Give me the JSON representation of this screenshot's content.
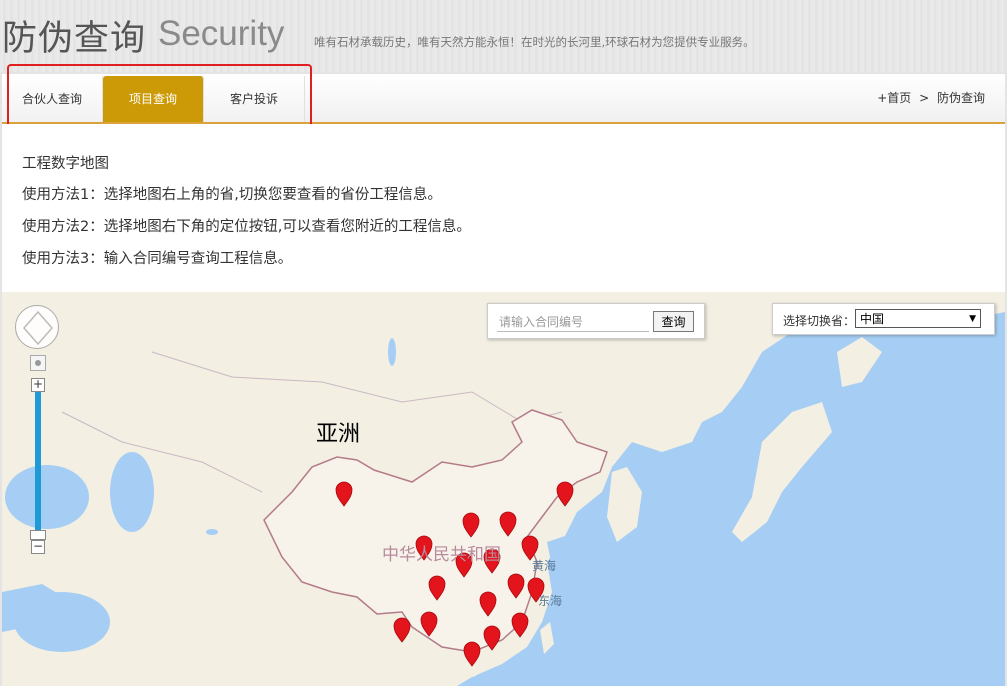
{
  "header": {
    "title_cn": "防伪查询",
    "title_en": "Security",
    "slogan": "唯有石材承载历史，唯有天然方能永恒！在时光的长河里,环球石材为您提供专业服务。"
  },
  "nav": {
    "tabs": [
      {
        "label": "合伙人查询",
        "active": false
      },
      {
        "label": "项目查询",
        "active": true
      },
      {
        "label": "客户投诉",
        "active": false
      }
    ],
    "breadcrumb": {
      "home": "+首页",
      "separator": ">",
      "current": "防伪查询"
    },
    "accent_color": "#cc9a07"
  },
  "content": {
    "heading": "工程数字地图",
    "instructions": [
      "使用方法1：选择地图右上角的省,切换您要查看的省份工程信息。",
      "使用方法2：选择地图右下角的定位按钮,可以查看您附近的工程信息。",
      "使用方法3：输入合同编号查询工程信息。"
    ]
  },
  "map": {
    "search": {
      "placeholder": "请输入合同编号",
      "button": "查询"
    },
    "province": {
      "label": "选择切换省：",
      "selected": "中国"
    },
    "labels": {
      "continent": "亚洲",
      "country": "中华人民共和国",
      "yellow_sea": "黄海",
      "east_sea": "东海"
    },
    "marker_color": "#e3141b",
    "icons": [
      "pan-control-icon",
      "locate-icon",
      "zoom-in-icon",
      "zoom-out-icon",
      "map-marker-icon"
    ]
  }
}
